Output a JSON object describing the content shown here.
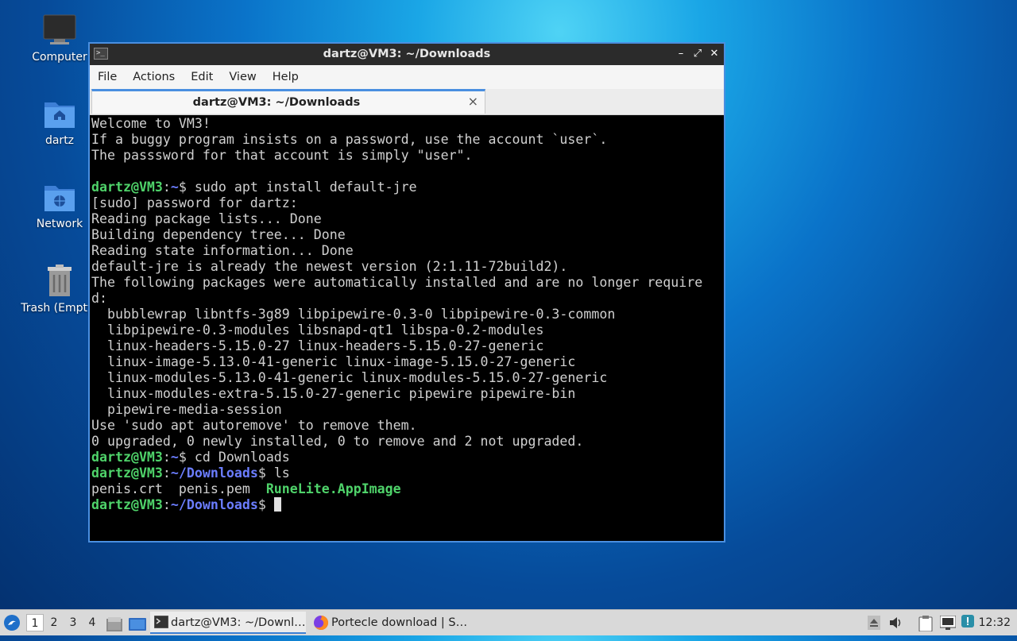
{
  "desktop": {
    "icons": [
      {
        "label": "Computer"
      },
      {
        "label": "dartz"
      },
      {
        "label": "Network"
      },
      {
        "label": "Trash (Empty)"
      }
    ]
  },
  "window": {
    "title": "dartz@VM3: ~/Downloads",
    "menu": [
      "File",
      "Actions",
      "Edit",
      "View",
      "Help"
    ],
    "tab_title": "dartz@VM3: ~/Downloads",
    "tab_close": "×"
  },
  "terminal": {
    "motd": [
      "Welcome to VM3!",
      "If a buggy program insists on a password, use the account `user`.",
      "The passsword for that account is simply \"user\"."
    ],
    "prompt_user": "dartz@VM3",
    "prompt_home": "~",
    "prompt_downloads": "~/Downloads",
    "cmd1": "sudo apt install default-jre",
    "output1": [
      "[sudo] password for dartz:",
      "Reading package lists... Done",
      "Building dependency tree... Done",
      "Reading state information... Done",
      "default-jre is already the newest version (2:1.11-72build2).",
      "The following packages were automatically installed and are no longer require",
      "d:",
      "  bubblewrap libntfs-3g89 libpipewire-0.3-0 libpipewire-0.3-common",
      "  libpipewire-0.3-modules libsnapd-qt1 libspa-0.2-modules",
      "  linux-headers-5.15.0-27 linux-headers-5.15.0-27-generic",
      "  linux-image-5.13.0-41-generic linux-image-5.15.0-27-generic",
      "  linux-modules-5.13.0-41-generic linux-modules-5.15.0-27-generic",
      "  linux-modules-extra-5.15.0-27-generic pipewire pipewire-bin",
      "  pipewire-media-session",
      "Use 'sudo apt autoremove' to remove them.",
      "0 upgraded, 0 newly installed, 0 to remove and 2 not upgraded."
    ],
    "cmd2": "cd Downloads",
    "cmd3": "ls",
    "ls_files": [
      "penis.crt",
      "penis.pem"
    ],
    "ls_exec": "RuneLite.AppImage"
  },
  "taskbar": {
    "workspaces": [
      "1",
      "2",
      "3",
      "4"
    ],
    "tasks": [
      {
        "label": "dartz@VM3: ~/Downl…",
        "icon": "terminal-icon"
      },
      {
        "label": "Portecle download | S…",
        "icon": "firefox-icon"
      }
    ],
    "clock": "12:32"
  },
  "colors": {
    "prompt_user": "#4fd36a",
    "prompt_path": "#6b7dff",
    "window_border": "#4a8fe0"
  }
}
